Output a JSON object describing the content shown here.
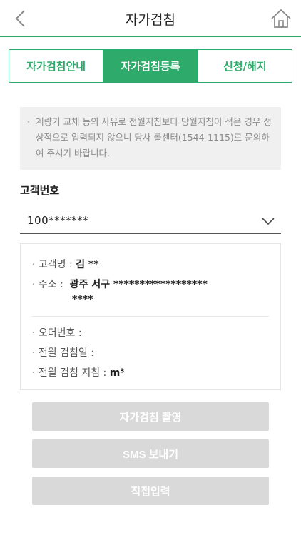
{
  "header": {
    "title": "자가검침"
  },
  "tabs": [
    {
      "label": "자가검침안내"
    },
    {
      "label": "자가검침등록"
    },
    {
      "label": "신청/해지"
    }
  ],
  "notice": {
    "text": "계량기 교체 등의 사유로 전월지침보다 당월지침이 적은 경우 정상적으로 입력되지 않으니 당사 콜센터(1544-1115)로 문의하여 주시기 바랍니다."
  },
  "customer": {
    "label": "고객번호",
    "selected": "100*******"
  },
  "info": {
    "name_label": "고객명 :",
    "name_value": "김 **",
    "address_label": "주소 :",
    "address_line1": "광주 서구 ******************",
    "address_line2": "****",
    "order_label": "오더번호 :",
    "prev_date_label": "전월 검침일 :",
    "prev_reading_label": "전월 검침 지침 :",
    "prev_reading_unit": "m³"
  },
  "buttons": {
    "photo": "자가검침 촬영",
    "sms": "SMS 보내기",
    "manual": "직접입력"
  },
  "colors": {
    "accent": "#2eab6a",
    "disabled_button": "#d9d9d9",
    "notice_bg": "#f0f0f0"
  }
}
